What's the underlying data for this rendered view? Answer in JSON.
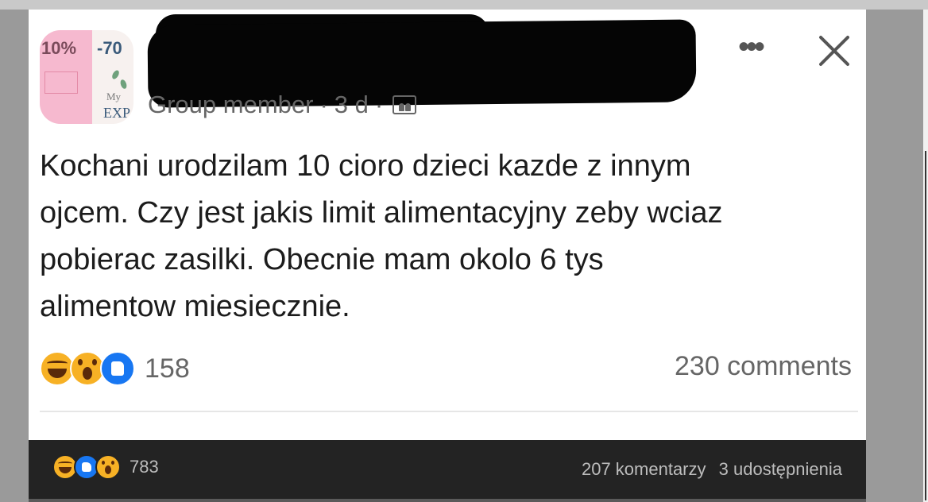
{
  "post": {
    "author_role": "Group member",
    "time": "3 d",
    "separator": "·",
    "more_label": "•••",
    "text_lines": [
      "Kochani urodzilam 10 cioro dzieci kazde z innym",
      "ojcem. Czy jest jakis limit alimentacyjny zeby wciaz",
      "pobierac zasilki. Obecnie mam okolo 6 tys",
      "alimentow miesiecznie."
    ],
    "reactions_count": "158",
    "comments_label": "230 comments"
  },
  "avatar": {
    "text_1": "10%",
    "text_2": "-70",
    "text_3": "My",
    "text_4": "EXP"
  },
  "repost_bar": {
    "reactions_count": "783",
    "comments_label": "207 komentarzy",
    "shares_label": "3 udostępnienia"
  },
  "icons": {
    "reactions_main": [
      "haha-icon",
      "wow-icon",
      "like-icon"
    ],
    "reactions_bar": [
      "haha-icon",
      "like-icon",
      "wow-icon"
    ],
    "audience": "group-audience-icon",
    "close": "close-icon",
    "more": "more-options-icon"
  },
  "colors": {
    "like_blue": "#1877f2",
    "emoji_yellow": "#f7b125",
    "meta_gray": "#666666",
    "dark_bar": "#232323"
  }
}
